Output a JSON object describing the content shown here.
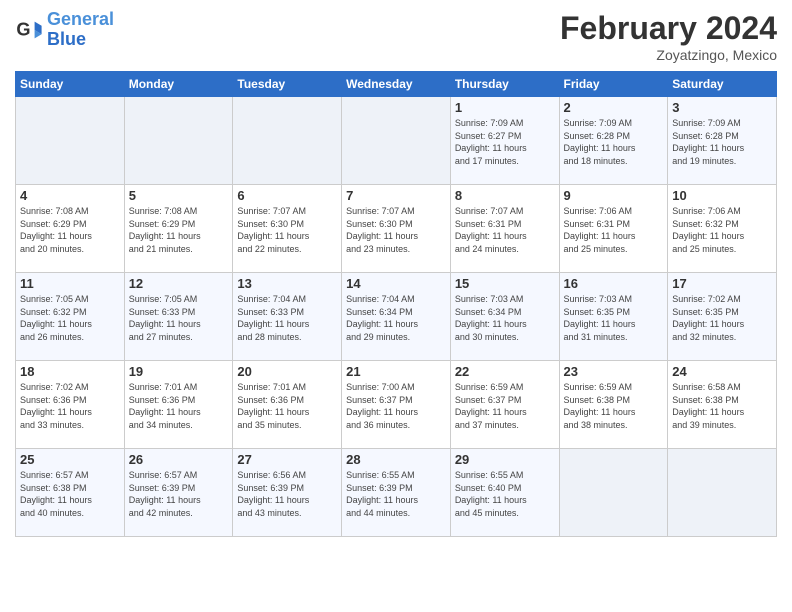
{
  "header": {
    "logo_line1": "General",
    "logo_line2": "Blue",
    "title": "February 2024",
    "subtitle": "Zoyatzingo, Mexico"
  },
  "weekdays": [
    "Sunday",
    "Monday",
    "Tuesday",
    "Wednesday",
    "Thursday",
    "Friday",
    "Saturday"
  ],
  "weeks": [
    [
      {
        "day": "",
        "info": ""
      },
      {
        "day": "",
        "info": ""
      },
      {
        "day": "",
        "info": ""
      },
      {
        "day": "",
        "info": ""
      },
      {
        "day": "1",
        "info": "Sunrise: 7:09 AM\nSunset: 6:27 PM\nDaylight: 11 hours\nand 17 minutes."
      },
      {
        "day": "2",
        "info": "Sunrise: 7:09 AM\nSunset: 6:28 PM\nDaylight: 11 hours\nand 18 minutes."
      },
      {
        "day": "3",
        "info": "Sunrise: 7:09 AM\nSunset: 6:28 PM\nDaylight: 11 hours\nand 19 minutes."
      }
    ],
    [
      {
        "day": "4",
        "info": "Sunrise: 7:08 AM\nSunset: 6:29 PM\nDaylight: 11 hours\nand 20 minutes."
      },
      {
        "day": "5",
        "info": "Sunrise: 7:08 AM\nSunset: 6:29 PM\nDaylight: 11 hours\nand 21 minutes."
      },
      {
        "day": "6",
        "info": "Sunrise: 7:07 AM\nSunset: 6:30 PM\nDaylight: 11 hours\nand 22 minutes."
      },
      {
        "day": "7",
        "info": "Sunrise: 7:07 AM\nSunset: 6:30 PM\nDaylight: 11 hours\nand 23 minutes."
      },
      {
        "day": "8",
        "info": "Sunrise: 7:07 AM\nSunset: 6:31 PM\nDaylight: 11 hours\nand 24 minutes."
      },
      {
        "day": "9",
        "info": "Sunrise: 7:06 AM\nSunset: 6:31 PM\nDaylight: 11 hours\nand 25 minutes."
      },
      {
        "day": "10",
        "info": "Sunrise: 7:06 AM\nSunset: 6:32 PM\nDaylight: 11 hours\nand 25 minutes."
      }
    ],
    [
      {
        "day": "11",
        "info": "Sunrise: 7:05 AM\nSunset: 6:32 PM\nDaylight: 11 hours\nand 26 minutes."
      },
      {
        "day": "12",
        "info": "Sunrise: 7:05 AM\nSunset: 6:33 PM\nDaylight: 11 hours\nand 27 minutes."
      },
      {
        "day": "13",
        "info": "Sunrise: 7:04 AM\nSunset: 6:33 PM\nDaylight: 11 hours\nand 28 minutes."
      },
      {
        "day": "14",
        "info": "Sunrise: 7:04 AM\nSunset: 6:34 PM\nDaylight: 11 hours\nand 29 minutes."
      },
      {
        "day": "15",
        "info": "Sunrise: 7:03 AM\nSunset: 6:34 PM\nDaylight: 11 hours\nand 30 minutes."
      },
      {
        "day": "16",
        "info": "Sunrise: 7:03 AM\nSunset: 6:35 PM\nDaylight: 11 hours\nand 31 minutes."
      },
      {
        "day": "17",
        "info": "Sunrise: 7:02 AM\nSunset: 6:35 PM\nDaylight: 11 hours\nand 32 minutes."
      }
    ],
    [
      {
        "day": "18",
        "info": "Sunrise: 7:02 AM\nSunset: 6:36 PM\nDaylight: 11 hours\nand 33 minutes."
      },
      {
        "day": "19",
        "info": "Sunrise: 7:01 AM\nSunset: 6:36 PM\nDaylight: 11 hours\nand 34 minutes."
      },
      {
        "day": "20",
        "info": "Sunrise: 7:01 AM\nSunset: 6:36 PM\nDaylight: 11 hours\nand 35 minutes."
      },
      {
        "day": "21",
        "info": "Sunrise: 7:00 AM\nSunset: 6:37 PM\nDaylight: 11 hours\nand 36 minutes."
      },
      {
        "day": "22",
        "info": "Sunrise: 6:59 AM\nSunset: 6:37 PM\nDaylight: 11 hours\nand 37 minutes."
      },
      {
        "day": "23",
        "info": "Sunrise: 6:59 AM\nSunset: 6:38 PM\nDaylight: 11 hours\nand 38 minutes."
      },
      {
        "day": "24",
        "info": "Sunrise: 6:58 AM\nSunset: 6:38 PM\nDaylight: 11 hours\nand 39 minutes."
      }
    ],
    [
      {
        "day": "25",
        "info": "Sunrise: 6:57 AM\nSunset: 6:38 PM\nDaylight: 11 hours\nand 40 minutes."
      },
      {
        "day": "26",
        "info": "Sunrise: 6:57 AM\nSunset: 6:39 PM\nDaylight: 11 hours\nand 42 minutes."
      },
      {
        "day": "27",
        "info": "Sunrise: 6:56 AM\nSunset: 6:39 PM\nDaylight: 11 hours\nand 43 minutes."
      },
      {
        "day": "28",
        "info": "Sunrise: 6:55 AM\nSunset: 6:39 PM\nDaylight: 11 hours\nand 44 minutes."
      },
      {
        "day": "29",
        "info": "Sunrise: 6:55 AM\nSunset: 6:40 PM\nDaylight: 11 hours\nand 45 minutes."
      },
      {
        "day": "",
        "info": ""
      },
      {
        "day": "",
        "info": ""
      }
    ]
  ]
}
